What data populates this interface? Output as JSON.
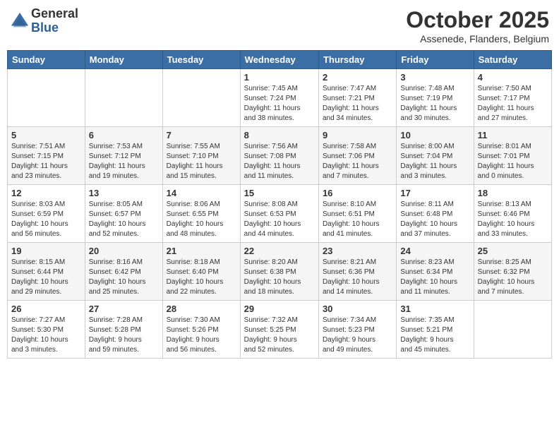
{
  "header": {
    "logo_general": "General",
    "logo_blue": "Blue",
    "month_title": "October 2025",
    "location": "Assenede, Flanders, Belgium"
  },
  "days_of_week": [
    "Sunday",
    "Monday",
    "Tuesday",
    "Wednesday",
    "Thursday",
    "Friday",
    "Saturday"
  ],
  "weeks": [
    [
      {
        "num": "",
        "info": ""
      },
      {
        "num": "",
        "info": ""
      },
      {
        "num": "",
        "info": ""
      },
      {
        "num": "1",
        "info": "Sunrise: 7:45 AM\nSunset: 7:24 PM\nDaylight: 11 hours\nand 38 minutes."
      },
      {
        "num": "2",
        "info": "Sunrise: 7:47 AM\nSunset: 7:21 PM\nDaylight: 11 hours\nand 34 minutes."
      },
      {
        "num": "3",
        "info": "Sunrise: 7:48 AM\nSunset: 7:19 PM\nDaylight: 11 hours\nand 30 minutes."
      },
      {
        "num": "4",
        "info": "Sunrise: 7:50 AM\nSunset: 7:17 PM\nDaylight: 11 hours\nand 27 minutes."
      }
    ],
    [
      {
        "num": "5",
        "info": "Sunrise: 7:51 AM\nSunset: 7:15 PM\nDaylight: 11 hours\nand 23 minutes."
      },
      {
        "num": "6",
        "info": "Sunrise: 7:53 AM\nSunset: 7:12 PM\nDaylight: 11 hours\nand 19 minutes."
      },
      {
        "num": "7",
        "info": "Sunrise: 7:55 AM\nSunset: 7:10 PM\nDaylight: 11 hours\nand 15 minutes."
      },
      {
        "num": "8",
        "info": "Sunrise: 7:56 AM\nSunset: 7:08 PM\nDaylight: 11 hours\nand 11 minutes."
      },
      {
        "num": "9",
        "info": "Sunrise: 7:58 AM\nSunset: 7:06 PM\nDaylight: 11 hours\nand 7 minutes."
      },
      {
        "num": "10",
        "info": "Sunrise: 8:00 AM\nSunset: 7:04 PM\nDaylight: 11 hours\nand 3 minutes."
      },
      {
        "num": "11",
        "info": "Sunrise: 8:01 AM\nSunset: 7:01 PM\nDaylight: 11 hours\nand 0 minutes."
      }
    ],
    [
      {
        "num": "12",
        "info": "Sunrise: 8:03 AM\nSunset: 6:59 PM\nDaylight: 10 hours\nand 56 minutes."
      },
      {
        "num": "13",
        "info": "Sunrise: 8:05 AM\nSunset: 6:57 PM\nDaylight: 10 hours\nand 52 minutes."
      },
      {
        "num": "14",
        "info": "Sunrise: 8:06 AM\nSunset: 6:55 PM\nDaylight: 10 hours\nand 48 minutes."
      },
      {
        "num": "15",
        "info": "Sunrise: 8:08 AM\nSunset: 6:53 PM\nDaylight: 10 hours\nand 44 minutes."
      },
      {
        "num": "16",
        "info": "Sunrise: 8:10 AM\nSunset: 6:51 PM\nDaylight: 10 hours\nand 41 minutes."
      },
      {
        "num": "17",
        "info": "Sunrise: 8:11 AM\nSunset: 6:48 PM\nDaylight: 10 hours\nand 37 minutes."
      },
      {
        "num": "18",
        "info": "Sunrise: 8:13 AM\nSunset: 6:46 PM\nDaylight: 10 hours\nand 33 minutes."
      }
    ],
    [
      {
        "num": "19",
        "info": "Sunrise: 8:15 AM\nSunset: 6:44 PM\nDaylight: 10 hours\nand 29 minutes."
      },
      {
        "num": "20",
        "info": "Sunrise: 8:16 AM\nSunset: 6:42 PM\nDaylight: 10 hours\nand 25 minutes."
      },
      {
        "num": "21",
        "info": "Sunrise: 8:18 AM\nSunset: 6:40 PM\nDaylight: 10 hours\nand 22 minutes."
      },
      {
        "num": "22",
        "info": "Sunrise: 8:20 AM\nSunset: 6:38 PM\nDaylight: 10 hours\nand 18 minutes."
      },
      {
        "num": "23",
        "info": "Sunrise: 8:21 AM\nSunset: 6:36 PM\nDaylight: 10 hours\nand 14 minutes."
      },
      {
        "num": "24",
        "info": "Sunrise: 8:23 AM\nSunset: 6:34 PM\nDaylight: 10 hours\nand 11 minutes."
      },
      {
        "num": "25",
        "info": "Sunrise: 8:25 AM\nSunset: 6:32 PM\nDaylight: 10 hours\nand 7 minutes."
      }
    ],
    [
      {
        "num": "26",
        "info": "Sunrise: 7:27 AM\nSunset: 5:30 PM\nDaylight: 10 hours\nand 3 minutes."
      },
      {
        "num": "27",
        "info": "Sunrise: 7:28 AM\nSunset: 5:28 PM\nDaylight: 9 hours\nand 59 minutes."
      },
      {
        "num": "28",
        "info": "Sunrise: 7:30 AM\nSunset: 5:26 PM\nDaylight: 9 hours\nand 56 minutes."
      },
      {
        "num": "29",
        "info": "Sunrise: 7:32 AM\nSunset: 5:25 PM\nDaylight: 9 hours\nand 52 minutes."
      },
      {
        "num": "30",
        "info": "Sunrise: 7:34 AM\nSunset: 5:23 PM\nDaylight: 9 hours\nand 49 minutes."
      },
      {
        "num": "31",
        "info": "Sunrise: 7:35 AM\nSunset: 5:21 PM\nDaylight: 9 hours\nand 45 minutes."
      },
      {
        "num": "",
        "info": ""
      }
    ]
  ]
}
